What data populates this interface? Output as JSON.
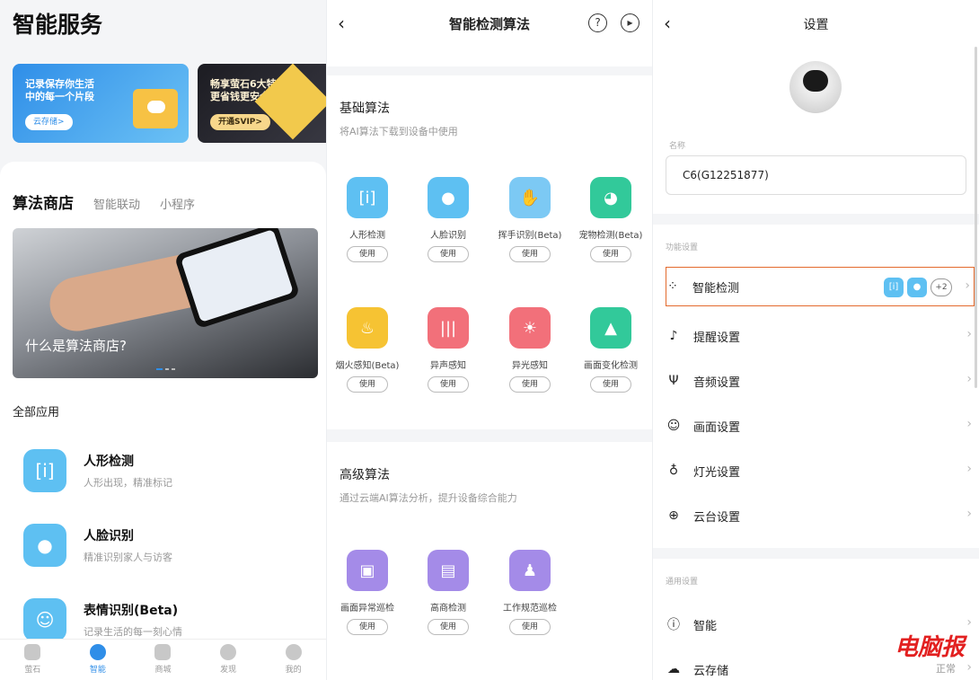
{
  "panel1": {
    "title": "智能服务",
    "banners": [
      {
        "text_line1": "记录保存你生活",
        "text_line2": "中的每一个片段",
        "button": "云存储>"
      },
      {
        "text_line1": "畅享萤石6大特权",
        "text_line2": "更省钱更安全",
        "button": "开通SVIP>"
      }
    ],
    "tabs": [
      "算法商店",
      "智能联动",
      "小程序"
    ],
    "hero_text": "什么是算法商店?",
    "all_apps_label": "全部应用",
    "apps": [
      {
        "name": "人形检测",
        "desc": "人形出现，精准标记",
        "icon": "person-frame-icon"
      },
      {
        "name": "人脸识别",
        "desc": "精准识别家人与访客",
        "icon": "face-icon"
      },
      {
        "name": "表情识别(Beta)",
        "desc": "记录生活的每一刻心情",
        "icon": "smile-icon"
      }
    ],
    "nav": [
      {
        "label": "萤石",
        "active": false
      },
      {
        "label": "智能",
        "active": true
      },
      {
        "label": "商城",
        "active": false
      },
      {
        "label": "发现",
        "active": false
      },
      {
        "label": "我的",
        "active": false
      }
    ]
  },
  "panel2": {
    "title": "智能检测算法",
    "help_icon": "?",
    "basic": {
      "title": "基础算法",
      "subtitle": "将AI算法下载到设备中使用",
      "items": [
        {
          "name": "人形检测",
          "button": "使用",
          "color": "#5ec0f2",
          "glyph": "[i]"
        },
        {
          "name": "人脸识别",
          "button": "使用",
          "color": "#5ec0f2",
          "glyph": "●"
        },
        {
          "name": "挥手识别(Beta)",
          "button": "使用",
          "color": "#7cc9f4",
          "glyph": "✋"
        },
        {
          "name": "宠物检测(Beta)",
          "button": "使用",
          "color": "#32c99a",
          "glyph": "◕"
        },
        {
          "name": "烟火感知(Beta)",
          "button": "使用",
          "color": "#f6c333",
          "glyph": "♨"
        },
        {
          "name": "异声感知",
          "button": "使用",
          "color": "#f2707a",
          "glyph": "|||"
        },
        {
          "name": "异光感知",
          "button": "使用",
          "color": "#f2707a",
          "glyph": "☀"
        },
        {
          "name": "画面变化检测",
          "button": "使用",
          "color": "#32c99a",
          "glyph": "▲"
        }
      ]
    },
    "advanced": {
      "title": "高级算法",
      "subtitle": "通过云端AI算法分析，提升设备综合能力",
      "items": [
        {
          "name": "画面异常巡检",
          "button": "使用",
          "color": "#a48be8",
          "glyph": "▣"
        },
        {
          "name": "高商检测",
          "button": "使用",
          "color": "#a48be8",
          "glyph": "▤"
        },
        {
          "name": "工作规范巡检",
          "button": "使用",
          "color": "#a48be8",
          "glyph": "♟"
        }
      ]
    }
  },
  "panel3": {
    "title": "设置",
    "name_label": "名称",
    "device_name": "C6(G12251877)",
    "function_section": "功能设置",
    "rows": [
      {
        "label": "智能检测",
        "icon": "grid-icon",
        "glyph": "⁘",
        "highlight": true,
        "count": "+2"
      },
      {
        "label": "提醒设置",
        "icon": "bell-icon",
        "glyph": "🔔"
      },
      {
        "label": "音频设置",
        "icon": "mic-icon",
        "glyph": "🎙"
      },
      {
        "label": "画面设置",
        "icon": "image-icon",
        "glyph": "☺"
      },
      {
        "label": "灯光设置",
        "icon": "bulb-icon",
        "glyph": "💡"
      },
      {
        "label": "云台设置",
        "icon": "globe-icon",
        "glyph": "⊕"
      }
    ],
    "general_section": "通用设置",
    "general_rows": [
      {
        "label": "智能",
        "icon": "info-icon",
        "glyph": "ⓘ",
        "right": ""
      },
      {
        "label": "云存储",
        "icon": "cloud-icon",
        "glyph": "☁",
        "right": "正常"
      }
    ],
    "watermark": "电脑报"
  }
}
